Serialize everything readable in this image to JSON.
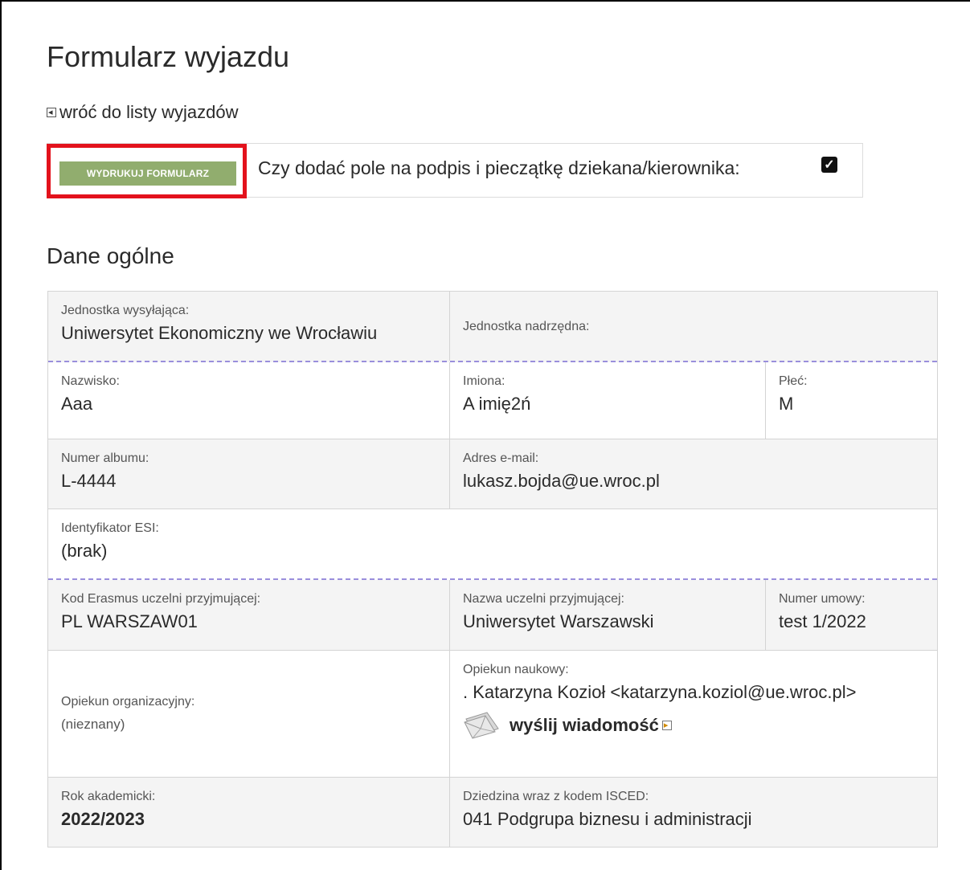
{
  "page": {
    "title": "Formularz wyjazdu",
    "back_link": "wróć do listy wyjazdów"
  },
  "print": {
    "button_label": "WYDRUKUJ FORMULARZ",
    "sign_question": "Czy dodać pole na podpis i pieczątkę dziekana/kierownika:",
    "sign_checked": true
  },
  "section": {
    "title": "Dane ogólne"
  },
  "fields": {
    "sending_unit": {
      "label": "Jednostka wysyłająca:",
      "value": "Uniwersytet Ekonomiczny we Wrocławiu"
    },
    "parent_unit": {
      "label": "Jednostka nadrzędna:",
      "value": ""
    },
    "surname": {
      "label": "Nazwisko:",
      "value": "Aaa"
    },
    "first_names": {
      "label": "Imiona:",
      "value": "A imię2ń"
    },
    "sex": {
      "label": "Płeć:",
      "value": "M"
    },
    "album_number": {
      "label": "Numer albumu:",
      "value": "L-4444"
    },
    "email": {
      "label": "Adres e-mail:",
      "value": "lukasz.bojda@ue.wroc.pl"
    },
    "esi_id": {
      "label": "Identyfikator ESI:",
      "value": "(brak)"
    },
    "erasmus_code": {
      "label": "Kod Erasmus uczelni przyjmującej:",
      "value": "PL WARSZAW01"
    },
    "host_name": {
      "label": "Nazwa uczelni przyjmującej:",
      "value": "Uniwersytet Warszawski"
    },
    "agreement_number": {
      "label": "Numer umowy:",
      "value": "test 1/2022"
    },
    "org_supervisor": {
      "label": "Opiekun organizacyjny:",
      "value": "(nieznany)"
    },
    "academic_supervisor": {
      "label": "Opiekun naukowy:",
      "value": ". Katarzyna Kozioł <katarzyna.koziol@ue.wroc.pl>",
      "send_label": "wyślij wiadomość"
    },
    "academic_year": {
      "label": "Rok akademicki:",
      "value": "2022/2023"
    },
    "field_isced": {
      "label": "Dziedzina wraz z kodem ISCED:",
      "value": "041 Podgrupa biznesu i administracji"
    }
  },
  "icons": {
    "back": "back-arrow-box-icon",
    "envelope": "envelope-icon",
    "external": "external-arrow-box-icon",
    "checkbox": "checkbox-checked-icon"
  },
  "colors": {
    "print_button_bg": "#91ad6e",
    "highlight_border": "#e3121c",
    "dashed_separator": "#9a8fdc"
  }
}
